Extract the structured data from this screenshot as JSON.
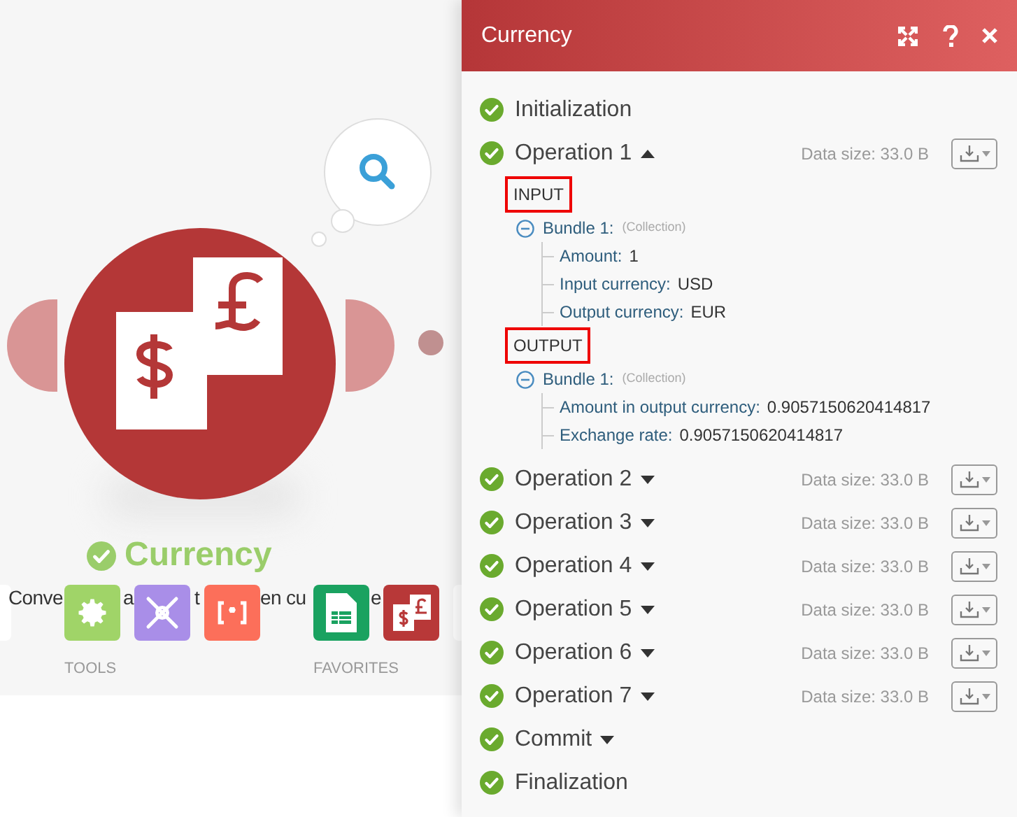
{
  "canvas": {
    "module": {
      "title": "Currency"
    },
    "description_fragments": [
      "Conve",
      "a",
      "t",
      "en cu",
      "e"
    ],
    "tool_groups": [
      {
        "label": "TOOLS",
        "tools": [
          {
            "kind": "gear"
          },
          {
            "kind": "tools"
          },
          {
            "kind": "brackets"
          }
        ]
      },
      {
        "label": "FAVORITES",
        "tools": [
          {
            "kind": "sheet"
          },
          {
            "kind": "currency"
          }
        ]
      }
    ]
  },
  "panel": {
    "title": "Currency",
    "stages": [
      {
        "label": "Initialization"
      },
      {
        "label": "Operation 1",
        "expanded": true,
        "data_size": "Data size: 33.0 B",
        "sections": [
          {
            "label": "INPUT",
            "bundles": [
              {
                "label": "Bundle 1:",
                "type": "(Collection)",
                "expanded": true,
                "fields": [
                  {
                    "key": "Amount:",
                    "value": "1"
                  },
                  {
                    "key": "Input currency:",
                    "value": "USD"
                  },
                  {
                    "key": "Output currency:",
                    "value": "EUR"
                  }
                ]
              }
            ]
          },
          {
            "label": "OUTPUT",
            "bundles": [
              {
                "label": "Bundle 1:",
                "type": "(Collection)",
                "expanded": true,
                "fields": [
                  {
                    "key": "Amount in output currency:",
                    "value": "0.9057150620414817"
                  },
                  {
                    "key": "Exchange rate:",
                    "value": "0.9057150620414817"
                  }
                ]
              }
            ]
          }
        ]
      },
      {
        "label": "Operation 2",
        "expanded": false,
        "data_size": "Data size: 33.0 B"
      },
      {
        "label": "Operation 3",
        "expanded": false,
        "data_size": "Data size: 33.0 B"
      },
      {
        "label": "Operation 4",
        "expanded": false,
        "data_size": "Data size: 33.0 B"
      },
      {
        "label": "Operation 5",
        "expanded": false,
        "data_size": "Data size: 33.0 B"
      },
      {
        "label": "Operation 6",
        "expanded": false,
        "data_size": "Data size: 33.0 B"
      },
      {
        "label": "Operation 7",
        "expanded": false,
        "data_size": "Data size: 33.0 B"
      },
      {
        "label": "Commit",
        "expanded": false
      },
      {
        "label": "Finalization"
      }
    ]
  }
}
